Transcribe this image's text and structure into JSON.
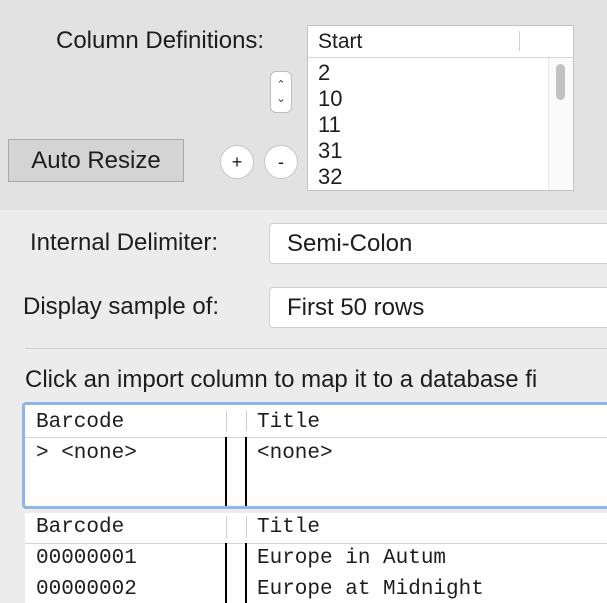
{
  "column_definitions": {
    "label": "Column Definitions:",
    "list_header": "Start",
    "values": [
      "2",
      "10",
      "11",
      "31",
      "32"
    ]
  },
  "buttons": {
    "auto_resize": "Auto Resize",
    "add": "+",
    "remove": "-"
  },
  "internal_delimiter": {
    "label": "Internal Delimiter:",
    "value": "Semi-Colon"
  },
  "display_sample": {
    "label": "Display sample of:",
    "value": "First 50 rows"
  },
  "instructions": "Click an import column to map it to a database fi",
  "mapping_table": {
    "columns": [
      "Barcode",
      "Title"
    ],
    "mapped": [
      "> <none>",
      "<none>"
    ]
  },
  "sample_table": {
    "columns": [
      "Barcode",
      "Title"
    ],
    "rows": [
      [
        "00000001",
        "Europe in Autum"
      ],
      [
        "00000002",
        "Europe at Midnight"
      ]
    ]
  },
  "colors": {
    "focus_ring": "#8fb5ea",
    "panel": "#e2e2e2",
    "window": "#ececec"
  }
}
